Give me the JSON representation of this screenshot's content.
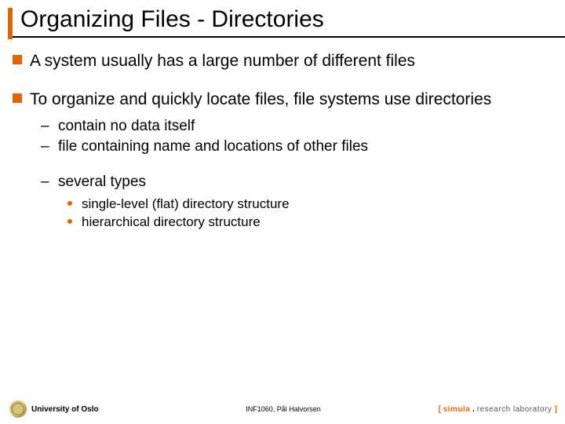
{
  "title": "Organizing Files - Directories",
  "bullets": [
    {
      "text": "A system usually has a large number of different files"
    },
    {
      "text": "To organize and quickly locate files, file systems use directories",
      "sub": [
        {
          "text": "contain no data itself"
        },
        {
          "text": "file containing name and locations of other files"
        },
        {
          "text": "several types",
          "gap": true,
          "sub": [
            {
              "text": "single-level (flat) directory structure"
            },
            {
              "text": "hierarchical directory structure"
            }
          ]
        }
      ]
    }
  ],
  "footer": {
    "left": "University of Oslo",
    "center": "INF1060, Pål Halvorsen",
    "right": {
      "open": "[ ",
      "brand": "simula",
      "sep": " . ",
      "rest": "research laboratory ",
      "close": "]"
    }
  }
}
